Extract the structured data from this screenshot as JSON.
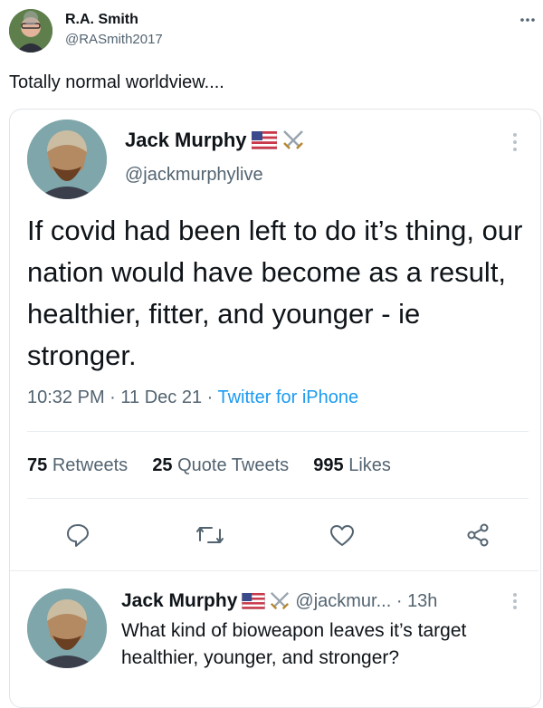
{
  "outer_tweet": {
    "author_name": "R.A. Smith",
    "author_handle": "@RASmith2017",
    "more_icon": "more-horizontal-icon",
    "text": "Totally normal worldview...."
  },
  "quoted_tweet": {
    "author_name": "Jack Murphy",
    "author_handle": "@jackmurphylive",
    "emoji_badges": [
      "us-flag-icon",
      "crossed-swords-icon"
    ],
    "text": "If covid had been left to do it’s thing, our nation would have become as a result, healthier, fitter, and younger - ie stronger.",
    "time": "10:32 PM",
    "date": "11 Dec 21",
    "source": "Twitter for iPhone",
    "stats": {
      "retweets_count": "75",
      "retweets_label": "Retweets",
      "quotes_count": "25",
      "quotes_label": "Quote Tweets",
      "likes_count": "995",
      "likes_label": "Likes"
    },
    "actions": [
      "reply-icon",
      "retweet-icon",
      "like-icon",
      "share-icon"
    ]
  },
  "reply_tweet": {
    "author_name": "Jack Murphy",
    "author_handle": "@jackmur...",
    "age": "13h",
    "text": "What kind of bioweapon leaves it’s target healthier, younger, and stronger?"
  },
  "colors": {
    "link": "#1d9bf0",
    "muted": "#536471",
    "border": "#e6ecf0"
  }
}
